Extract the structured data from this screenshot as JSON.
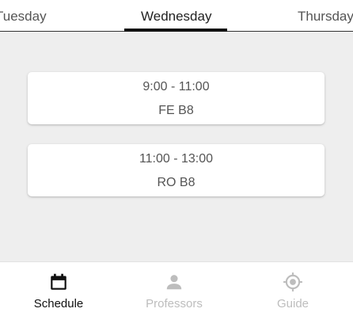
{
  "day_tabs": {
    "prev": "Tuesday",
    "active": "Wednesday",
    "next": "Thursday"
  },
  "schedule": [
    {
      "time": "9:00 - 11:00",
      "room": "FE B8"
    },
    {
      "time": "11:00 - 13:00",
      "room": "RO B8"
    }
  ],
  "bottom_nav": {
    "items": [
      {
        "label": "Schedule",
        "icon": "calendar-icon",
        "active": true
      },
      {
        "label": "Professors",
        "icon": "person-icon",
        "active": false
      },
      {
        "label": "Guide",
        "icon": "location-target-icon",
        "active": false
      }
    ]
  },
  "colors": {
    "active": "#111111",
    "inactive": "#bdbdbd",
    "background": "#eeeeee"
  }
}
